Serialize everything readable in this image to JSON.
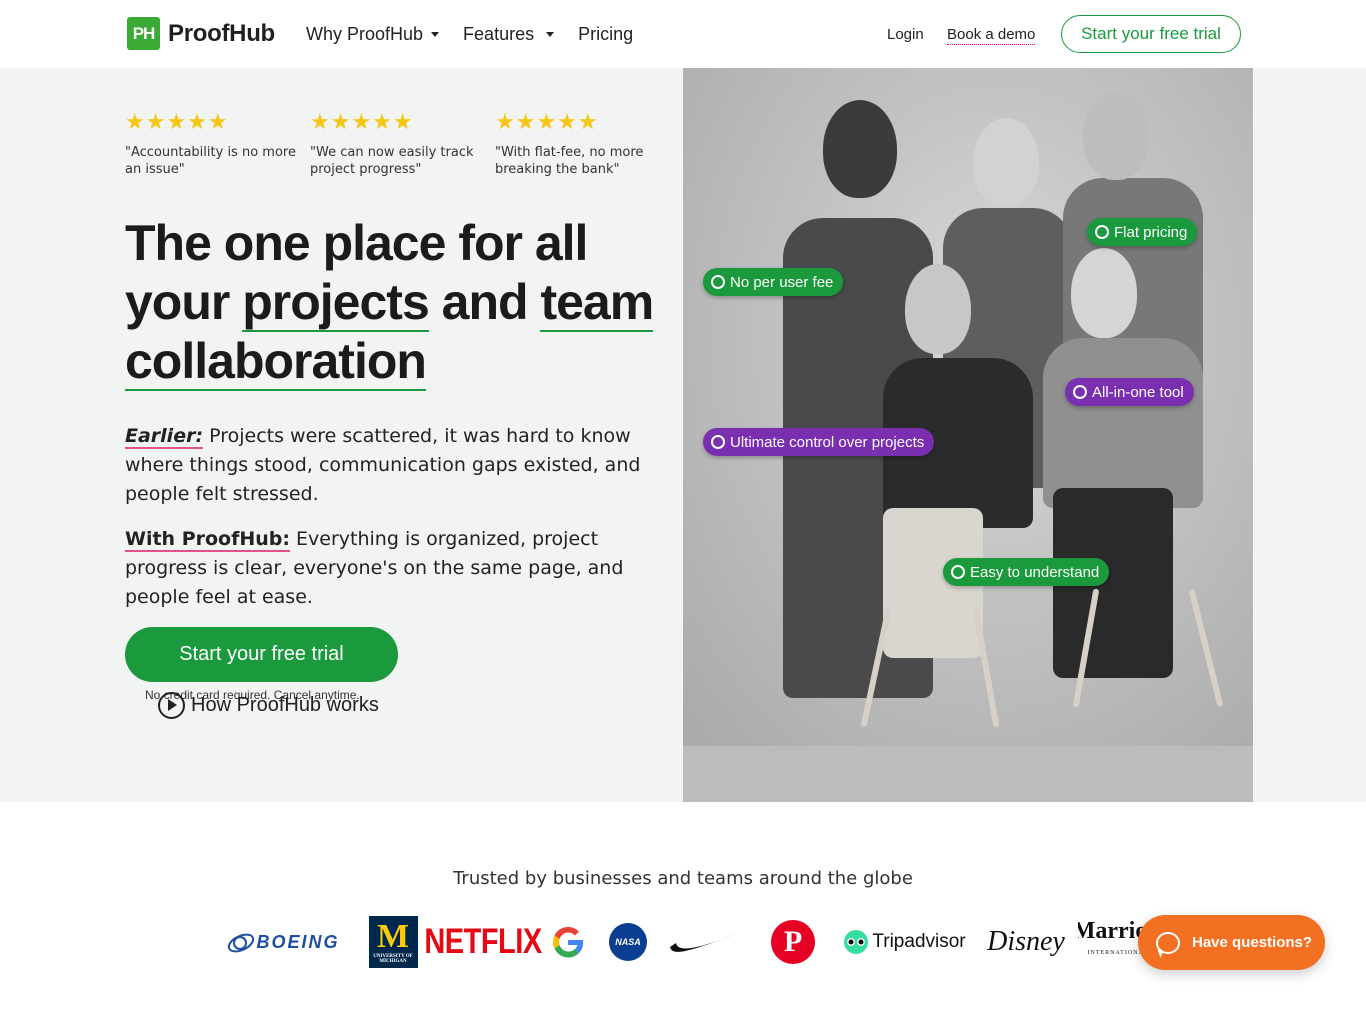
{
  "header": {
    "logo_mark": "PH",
    "logo_text": "ProofHub",
    "nav": [
      {
        "label": "Why ProofHub",
        "has_dropdown": true
      },
      {
        "label": "Features",
        "has_dropdown": true
      },
      {
        "label": "Pricing",
        "has_dropdown": false
      }
    ],
    "login": "Login",
    "book_demo": "Book a demo",
    "cta": "Start your free trial"
  },
  "reviews": [
    {
      "stars": "★★★★★",
      "quote": "\"Accountability is no more an issue\""
    },
    {
      "stars": "★★★★★",
      "quote": "\"We can now easily track project progress\""
    },
    {
      "stars": "★★★★★",
      "quote": "\"With flat-fee, no more breaking the bank\""
    }
  ],
  "hero": {
    "headline_1": "The one place for all",
    "headline_2": "your ",
    "headline_projects": "projects",
    "headline_and": " and ",
    "headline_team": "team",
    "headline_collab": "collaboration",
    "earlier_lead": "Earlier:",
    "earlier_text": " Projects were scattered, it was hard to know where things stood, communication gaps existed, and people felt stressed.",
    "with_lead": "With ProofHub:",
    "with_text": " Everything is organized, project progress is clear, everyone's on the same page, and people feel at ease.",
    "cta": "Start your free trial",
    "no_card": "No credit card required. Cancel anytime.",
    "how_works": "How ProofHub works"
  },
  "badges": {
    "flat_pricing": "Flat pricing",
    "no_per_user": "No per user fee",
    "all_in_one": "All-in-one tool",
    "ultimate_control": "Ultimate control over projects",
    "easy": "Easy to understand"
  },
  "trusted": {
    "title": "Trusted by businesses and teams around the globe",
    "logos": {
      "boeing": "BOEING",
      "michigan": "M",
      "michigan_sub": "UNIVERSITY OF MICHIGAN",
      "netflix": "NETFLIX",
      "google": "G",
      "nasa": "NASA",
      "pinterest": "P",
      "tripadvisor": "Tripadvisor",
      "disney": "Disney",
      "marriott": "Marriott",
      "marriott_sub": "INTERNATIONAL"
    }
  },
  "chat": {
    "label": "Have questions?"
  },
  "colors": {
    "brand_green": "#1a9a3d",
    "badge_purple": "#7a2fb0",
    "chat_orange": "#f36f21",
    "star_yellow": "#f6c614",
    "underline_pink": "#e6508a"
  }
}
